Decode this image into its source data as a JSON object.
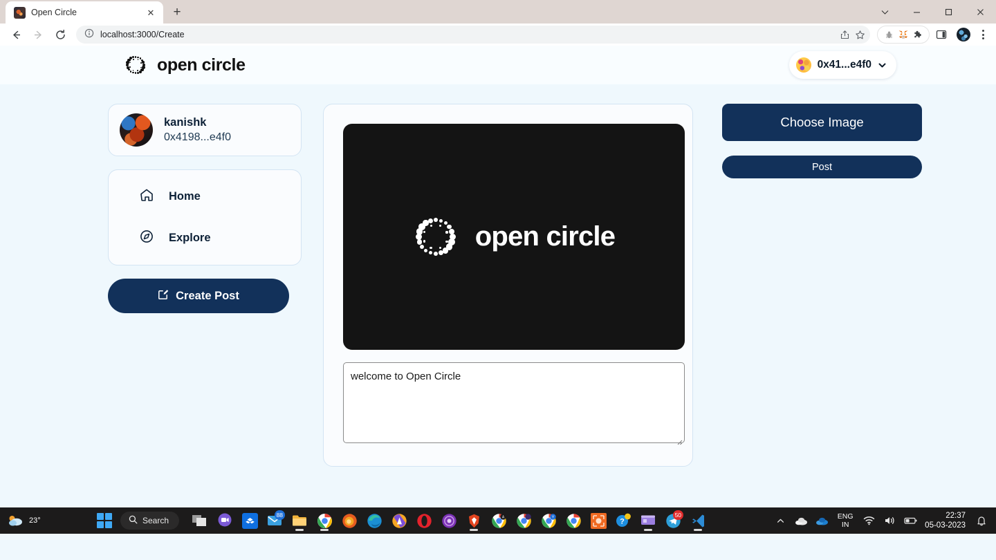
{
  "browser": {
    "tab_title": "Open Circle",
    "close_label": "✕",
    "newtab_label": "+",
    "url": "localhost:3000/Create",
    "icons": {
      "back": "back-arrow-icon",
      "forward": "forward-arrow-icon",
      "reload": "reload-icon",
      "info": "site-info-icon",
      "share": "share-icon",
      "bookmark": "bookmark-star-icon",
      "bug": "bug-extension-icon",
      "metamask": "metamask-fox-icon",
      "puzzle": "extensions-puzzle-icon",
      "sidepanel": "side-panel-icon",
      "profile": "profile-avatar-icon",
      "menu": "three-dot-menu-icon"
    }
  },
  "app": {
    "brand": "open circle",
    "wallet": {
      "address": "0x41...e4f0"
    },
    "profile": {
      "name": "kanishk",
      "address": "0x4198...e4f0"
    },
    "nav": [
      {
        "label": "Home",
        "icon": "home-icon"
      },
      {
        "label": "Explore",
        "icon": "compass-icon"
      }
    ],
    "create_post_label": "Create Post",
    "preview": {
      "brand": "open circle"
    },
    "caption": {
      "value": "welcome to Open Circle",
      "placeholder": ""
    },
    "actions": {
      "choose_image": "Choose Image",
      "post": "Post"
    },
    "colors": {
      "page_bg": "#eff8fd",
      "navy": "#12315a",
      "card_bg": "#fafcfe",
      "card_border": "#d3e4f3",
      "preview_bg": "#141414"
    }
  },
  "taskbar": {
    "weather_temp": "23°",
    "search_label": "Search",
    "language": "ENG",
    "region": "IN",
    "time": "22:37",
    "date": "05-03-2023",
    "apps": [
      {
        "name": "task-view",
        "badge": ""
      },
      {
        "name": "chat-app",
        "badge": ""
      },
      {
        "name": "dropbox",
        "badge": ""
      },
      {
        "name": "mail",
        "badge": "88"
      },
      {
        "name": "file-explorer",
        "badge": ""
      },
      {
        "name": "chrome",
        "badge": ""
      },
      {
        "name": "firefox",
        "badge": ""
      },
      {
        "name": "edge",
        "badge": ""
      },
      {
        "name": "avast",
        "badge": ""
      },
      {
        "name": "opera",
        "badge": ""
      },
      {
        "name": "tor-browser",
        "badge": ""
      },
      {
        "name": "brave",
        "badge": ""
      },
      {
        "name": "chrome-profile-a",
        "badge": ""
      },
      {
        "name": "chrome-profile-b",
        "badge": ""
      },
      {
        "name": "chrome-profile-y",
        "badge": ""
      },
      {
        "name": "chrome-profile-o",
        "badge": ""
      },
      {
        "name": "orange-app",
        "badge": ""
      },
      {
        "name": "help-app",
        "badge": ""
      },
      {
        "name": "media-app",
        "badge": ""
      },
      {
        "name": "telegram",
        "badge": "50"
      },
      {
        "name": "vs-code",
        "badge": ""
      }
    ]
  }
}
